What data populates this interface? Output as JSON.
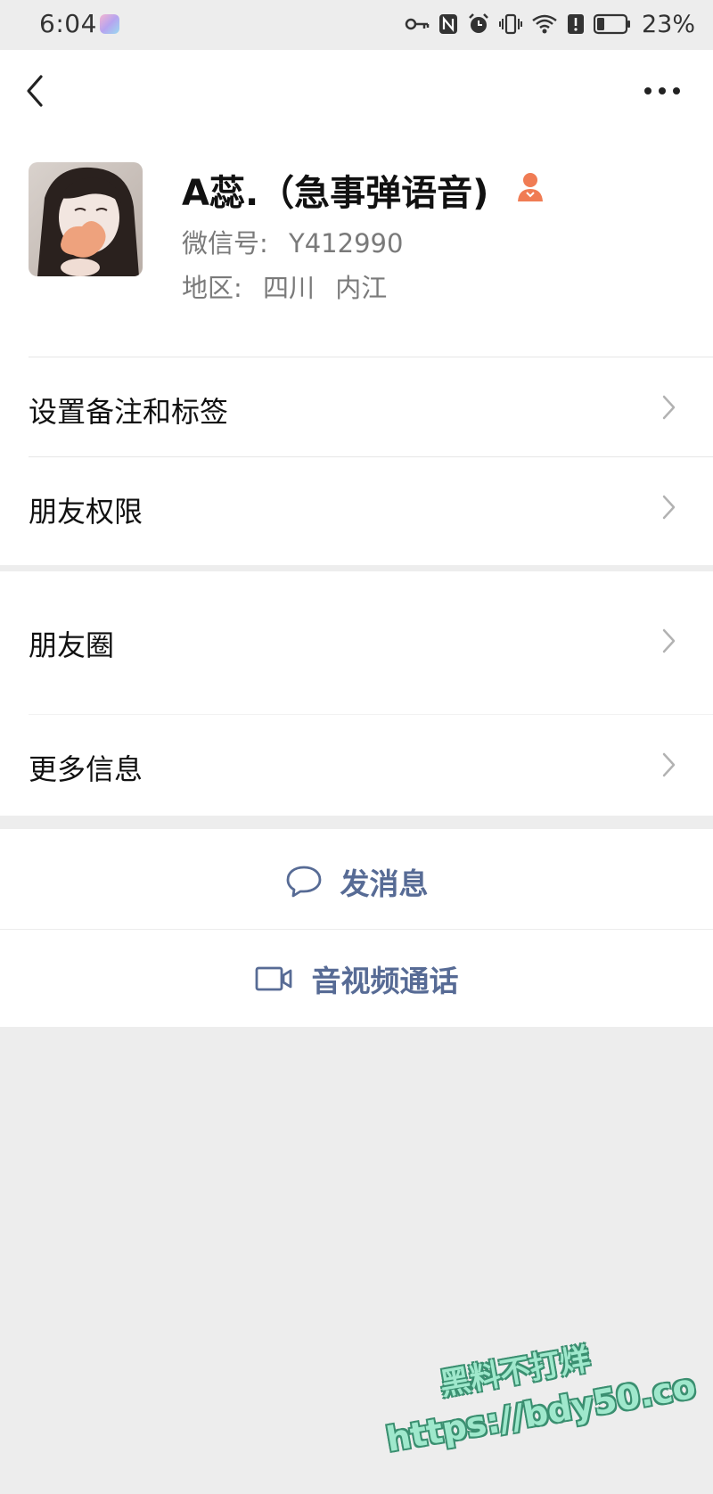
{
  "status_bar": {
    "time": "6:04",
    "battery_percent": "23%",
    "icons": [
      "key-icon",
      "nfc-icon",
      "alarm-icon",
      "vibrate-icon",
      "wifi-icon",
      "notification-icon",
      "battery-icon"
    ]
  },
  "nav": {
    "back_icon": "chevron-left-icon",
    "more_icon": "more-dots-icon"
  },
  "profile": {
    "name": "A蕊.（急事弹语音)",
    "wechat_id_label": "微信号:",
    "wechat_id": "Y412990",
    "region_label": "地区:",
    "region_province": "四川",
    "region_city": "内江",
    "name_badge_icon": "person-badge-icon"
  },
  "menu": {
    "remark_tags": "设置备注和标签",
    "friend_permissions": "朋友权限",
    "moments": "朋友圈",
    "more_info": "更多信息"
  },
  "actions": {
    "send_message": "发消息",
    "av_call": "音视频通话"
  },
  "watermark": {
    "line1": "黑料不打烊",
    "line2": "https://bdy50.co"
  },
  "colors": {
    "link_blue": "#576b95",
    "background_gray": "#ededed",
    "badge_orange": "#f07c54"
  }
}
